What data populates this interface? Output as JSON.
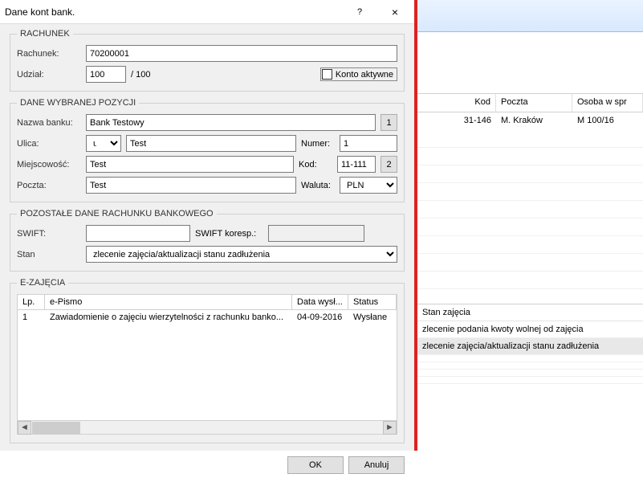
{
  "dialog": {
    "title": "Dane kont bank.",
    "rachunek": {
      "legend": "RACHUNEK",
      "rachunek_label": "Rachunek:",
      "rachunek_value": "70200001",
      "udzial_label": "Udział:",
      "udzial_value": "100",
      "udzial_suffix": "/ 100",
      "konto_aktywne_label": "Konto aktywne"
    },
    "pozycja": {
      "legend": "DANE WYBRANEJ POZYCJI",
      "nazwa_label": "Nazwa banku:",
      "nazwa_value": "Bank Testowy",
      "lookup_btn": "1",
      "ulica_label": "Ulica:",
      "ulica_type": "ul.",
      "ulica_value": "Test",
      "numer_label": "Numer:",
      "numer_value": "1",
      "miejscowosc_label": "Miejscowość:",
      "miejscowosc_value": "Test",
      "kod_label": "Kod:",
      "kod_value": "11-111",
      "kod_btn": "2",
      "poczta_label": "Poczta:",
      "poczta_value": "Test",
      "waluta_label": "Waluta:",
      "waluta_value": "PLN"
    },
    "pozostale": {
      "legend": "POZOSTAŁE DANE RACHUNKU BANKOWEGO",
      "swift_label": "SWIFT:",
      "swift_value": "",
      "swift_koresp_label": "SWIFT koresp.:",
      "swift_koresp_value": "",
      "stan_label": "Stan",
      "stan_value": "zlecenie zajęcia/aktualizacji stanu zadłużenia"
    },
    "ezajecia": {
      "legend": "E-ZAJĘCIA",
      "col_lp": "Lp.",
      "col_epismo": "e-Pismo",
      "col_data": "Data wysł...",
      "col_status": "Status",
      "row_lp": "1",
      "row_epismo": "Zawiadomienie o zajęciu wierzytelności z rachunku banko...",
      "row_data": "04-09-2016",
      "row_status": "Wysłane"
    },
    "buttons": {
      "ok": "OK",
      "cancel": "Anuluj"
    }
  },
  "bg": {
    "head_kod": "Kod",
    "head_poczta": "Poczta",
    "head_osoba": "Osoba w spr",
    "row_kod": "31-146",
    "row_poczta": "M. Kraków",
    "row_osoba": "M 100/16",
    "box_head": "Stan zajęcia",
    "box_item1": "zlecenie podania kwoty wolnej od zajęcia",
    "box_item2": "zlecenie zajęcia/aktualizacji stanu zadłużenia"
  }
}
